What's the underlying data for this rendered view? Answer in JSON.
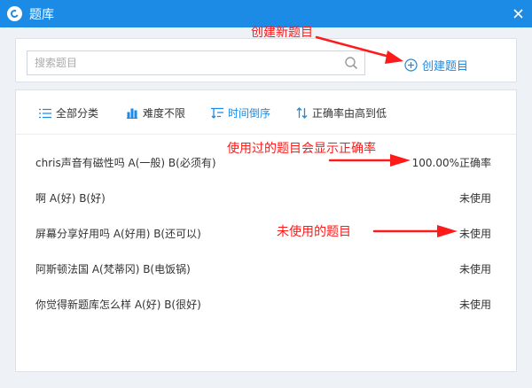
{
  "window": {
    "title": "题库"
  },
  "search": {
    "placeholder": "搜索题目"
  },
  "toolbar": {
    "create_label": "创建题目"
  },
  "filters": {
    "category": "全部分类",
    "difficulty": "难度不限",
    "time_order": "时间倒序",
    "accuracy_order": "正确率由高到低"
  },
  "questions": [
    {
      "text": "chris声音有磁性吗  A(一般)  B(必须有)",
      "status": "100.00%正确率"
    },
    {
      "text": "啊  A(好)  B(好)",
      "status": "未使用"
    },
    {
      "text": "屏幕分享好用吗  A(好用)  B(还可以)",
      "status": "未使用"
    },
    {
      "text": "阿斯顿法国  A(梵蒂冈)  B(电饭锅)",
      "status": "未使用"
    },
    {
      "text": "你觉得新题库怎么样  A(好)  B(很好)",
      "status": "未使用"
    }
  ],
  "annotations": {
    "create": "创建新题目",
    "used": "使用过的题目会显示正确率",
    "unused": "未使用的题目"
  },
  "colors": {
    "title_bar": "#1b8be6",
    "accent": "#1b8be6",
    "annotation": "#ff1a1a"
  },
  "icons": {
    "logo": "app-logo-icon",
    "close": "close-icon",
    "search": "search-icon",
    "create": "plus-circle-icon",
    "category": "list-icon",
    "difficulty": "bar-chart-icon",
    "time": "sort-time-icon",
    "accuracy": "sort-arrows-icon"
  }
}
